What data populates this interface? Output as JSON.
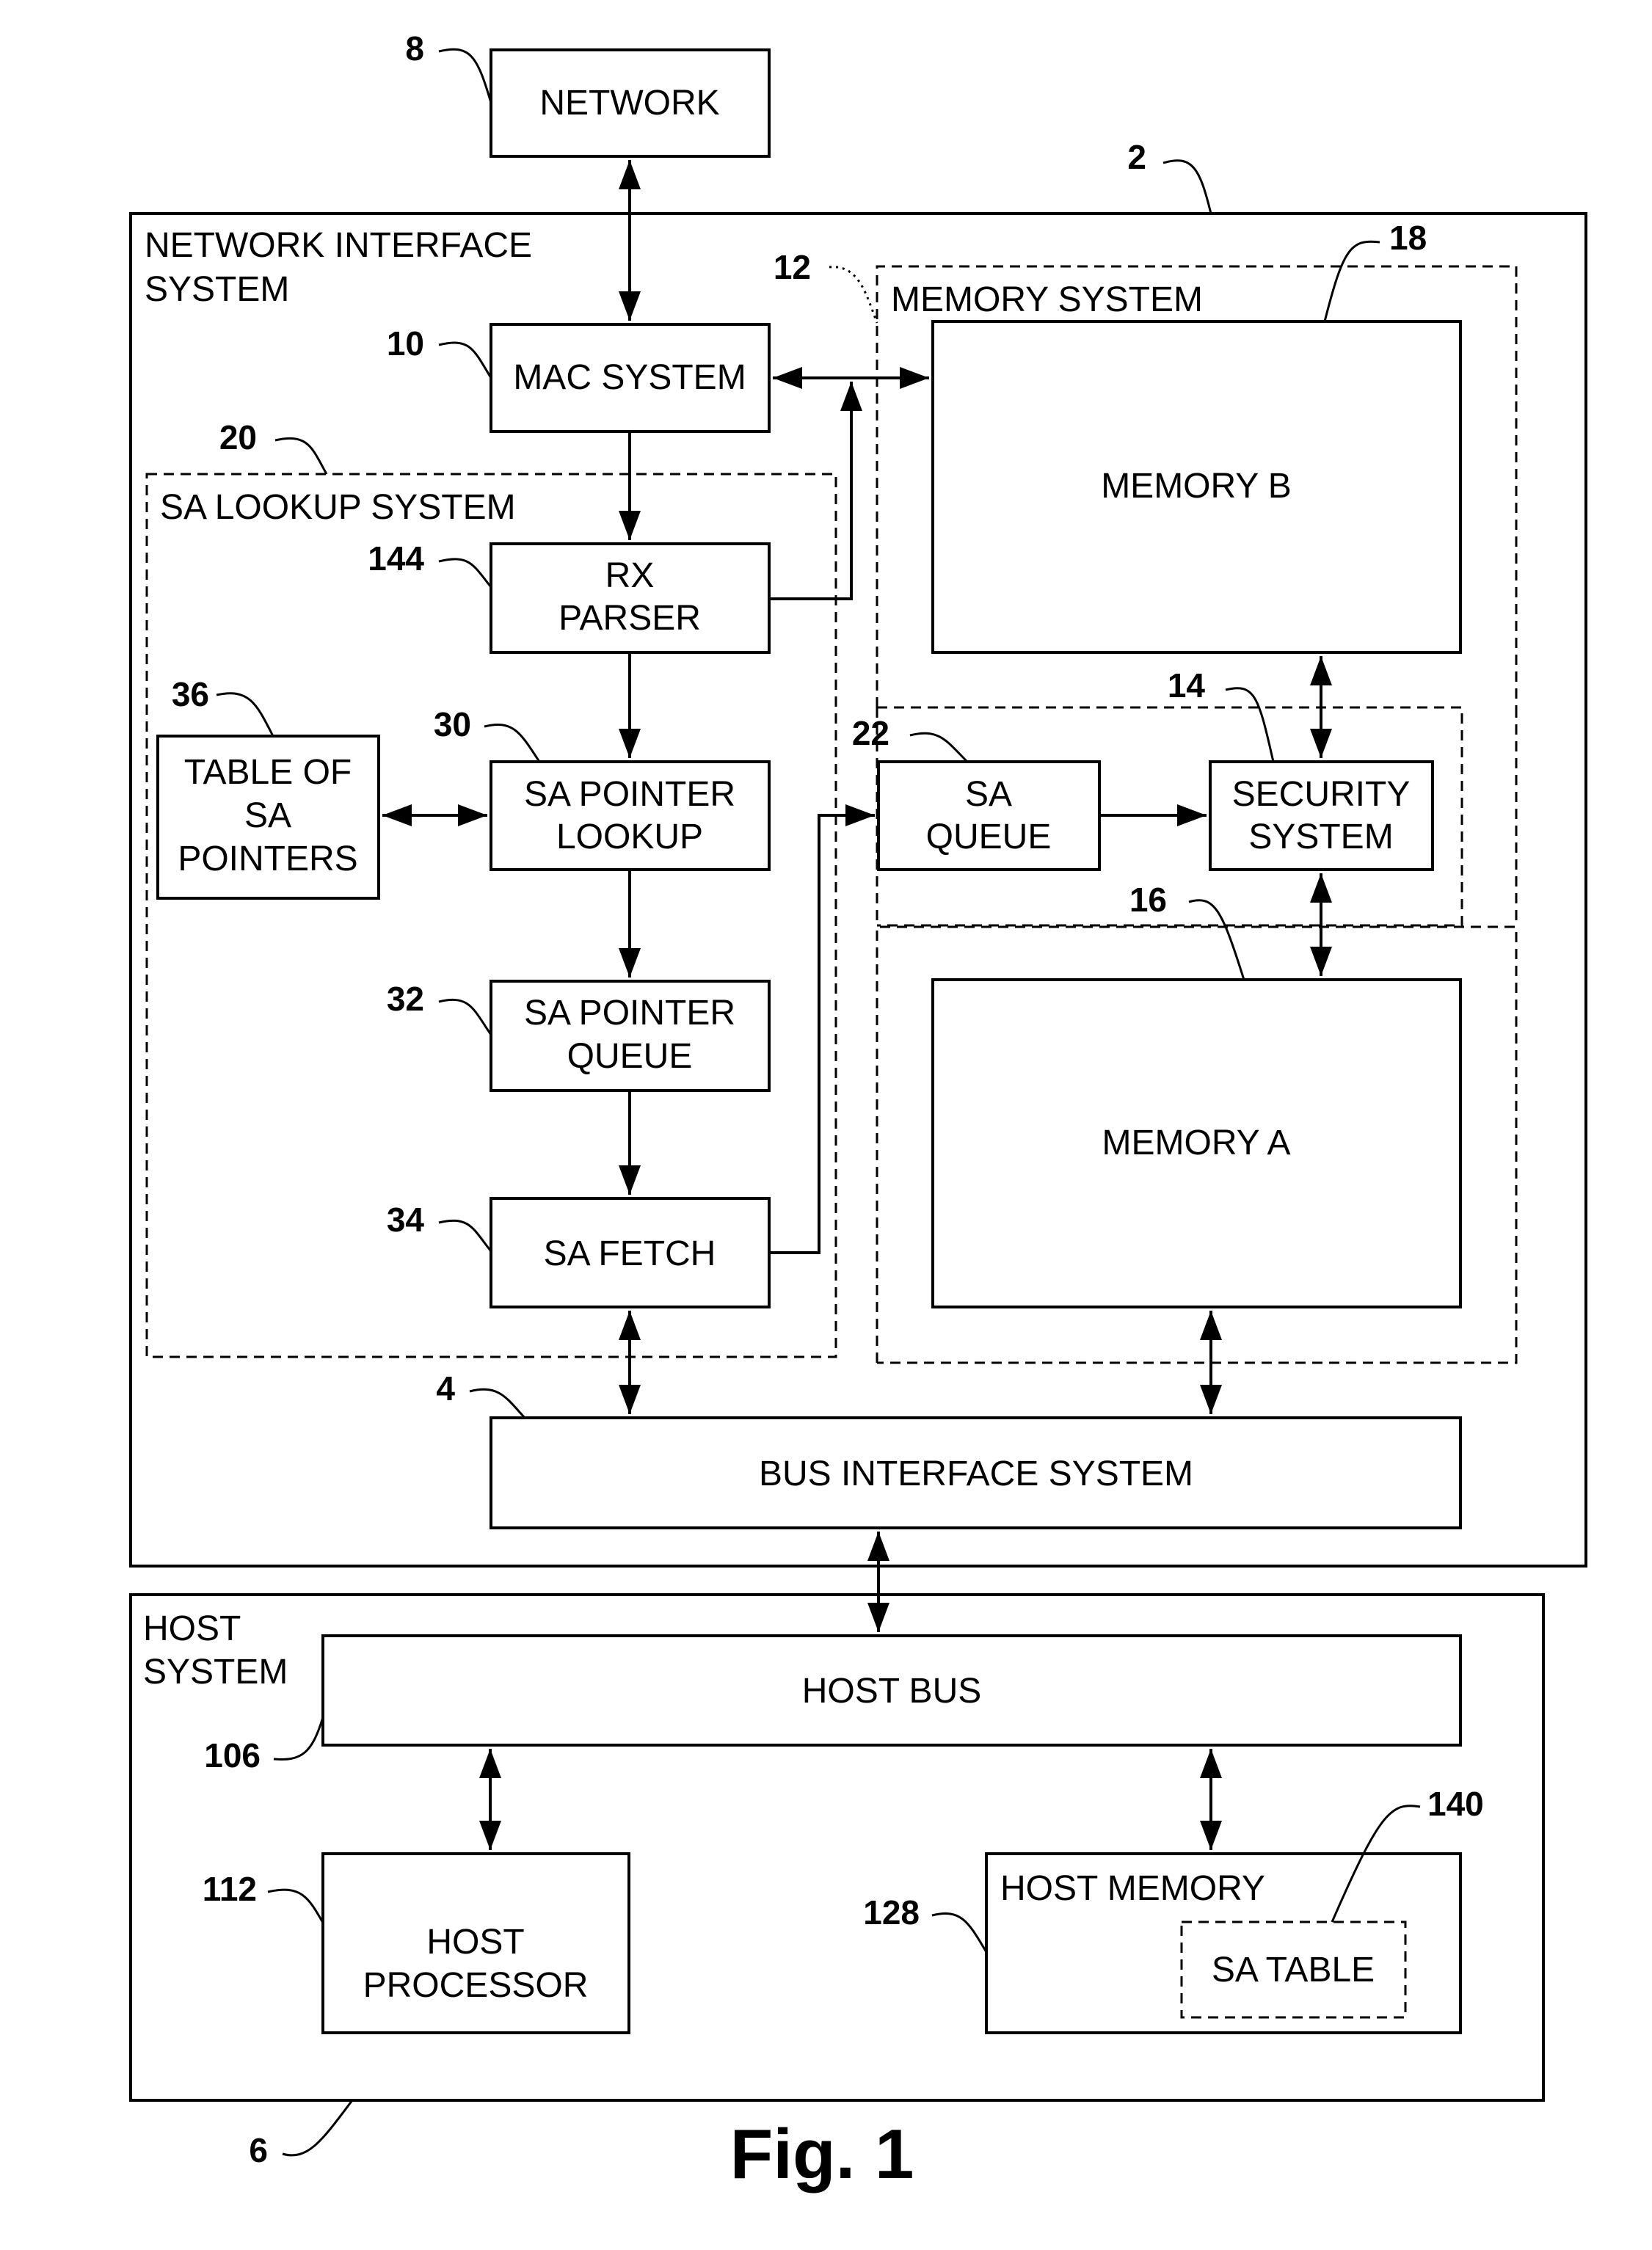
{
  "figure": {
    "caption": "Fig. 1"
  },
  "blocks": {
    "network": {
      "ref": "8",
      "lines": [
        "NETWORK"
      ]
    },
    "network_interface_system": {
      "ref": "2",
      "lines": [
        "NETWORK INTERFACE",
        "SYSTEM"
      ]
    },
    "mac_system": {
      "ref": "10",
      "lines": [
        "MAC SYSTEM"
      ]
    },
    "sa_lookup_system": {
      "ref": "20",
      "lines": [
        "SA LOOKUP SYSTEM"
      ]
    },
    "rx_parser": {
      "ref": "144",
      "lines": [
        "RX",
        "PARSER"
      ]
    },
    "memory_system": {
      "ref": "12",
      "lines": [
        "MEMORY SYSTEM"
      ]
    },
    "memory_b": {
      "ref": "18",
      "lines": [
        "MEMORY B"
      ]
    },
    "table_of_sa_pointers": {
      "ref": "36",
      "lines": [
        "TABLE OF",
        "SA",
        "POINTERS"
      ]
    },
    "sa_pointer_lookup": {
      "ref": "30",
      "lines": [
        "SA POINTER",
        "LOOKUP"
      ]
    },
    "sa_queue": {
      "ref": "22",
      "lines": [
        "SA",
        "QUEUE"
      ]
    },
    "security_system": {
      "ref": "14",
      "lines": [
        "SECURITY",
        "SYSTEM"
      ]
    },
    "memory_a_region": {
      "ref": "16"
    },
    "memory_a": {
      "lines": [
        "MEMORY A"
      ]
    },
    "sa_pointer_queue": {
      "ref": "32",
      "lines": [
        "SA POINTER",
        "QUEUE"
      ]
    },
    "sa_fetch": {
      "ref": "34",
      "lines": [
        "SA FETCH"
      ]
    },
    "bus_interface_system": {
      "ref": "4",
      "lines": [
        "BUS INTERFACE SYSTEM"
      ]
    },
    "host_system": {
      "ref": "6",
      "lines": [
        "HOST",
        "SYSTEM"
      ]
    },
    "host_bus": {
      "ref": "106",
      "lines": [
        "HOST BUS"
      ]
    },
    "host_processor": {
      "ref": "112",
      "lines": [
        "HOST",
        "PROCESSOR"
      ]
    },
    "host_memory": {
      "ref": "128",
      "lines": [
        "HOST MEMORY"
      ]
    },
    "sa_table": {
      "ref": "140",
      "lines": [
        "SA TABLE"
      ]
    }
  },
  "connections": [
    {
      "from": "network",
      "to": "mac_system",
      "direction": "bidirectional"
    },
    {
      "from": "mac_system",
      "to": "memory_b",
      "direction": "bidirectional"
    },
    {
      "from": "rx_parser",
      "to": "mac_system/memory_b bus",
      "direction": "forward"
    },
    {
      "from": "mac_system",
      "to": "rx_parser",
      "direction": "forward"
    },
    {
      "from": "rx_parser",
      "to": "sa_pointer_lookup",
      "direction": "forward"
    },
    {
      "from": "table_of_sa_pointers",
      "to": "sa_pointer_lookup",
      "direction": "bidirectional"
    },
    {
      "from": "sa_pointer_lookup",
      "to": "sa_pointer_queue",
      "direction": "forward"
    },
    {
      "from": "sa_pointer_queue",
      "to": "sa_fetch",
      "direction": "forward"
    },
    {
      "from": "sa_fetch",
      "to": "sa_queue",
      "direction": "forward"
    },
    {
      "from": "sa_queue",
      "to": "security_system",
      "direction": "forward"
    },
    {
      "from": "security_system",
      "to": "memory_b",
      "direction": "bidirectional"
    },
    {
      "from": "security_system",
      "to": "memory_a",
      "direction": "bidirectional"
    },
    {
      "from": "sa_fetch",
      "to": "bus_interface_system",
      "direction": "bidirectional"
    },
    {
      "from": "memory_a",
      "to": "bus_interface_system",
      "direction": "bidirectional"
    },
    {
      "from": "bus_interface_system",
      "to": "host_bus",
      "direction": "bidirectional"
    },
    {
      "from": "host_bus",
      "to": "host_processor",
      "direction": "bidirectional"
    },
    {
      "from": "host_bus",
      "to": "host_memory",
      "direction": "bidirectional"
    }
  ]
}
